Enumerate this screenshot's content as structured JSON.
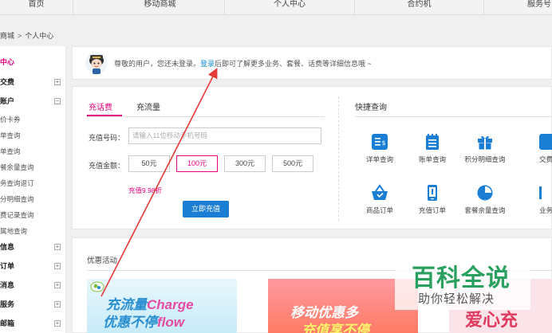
{
  "topnav": [
    "首页",
    "移动商城",
    "个人中心",
    "合约机",
    "服务号"
  ],
  "breadcrumb": [
    "商城",
    "个人中心"
  ],
  "sidebar": {
    "items": [
      {
        "label": "中心",
        "type": "active"
      },
      {
        "label": "交费",
        "type": "head",
        "toggle": "⊞"
      },
      {
        "label": "账户",
        "type": "head",
        "toggle": "⊟"
      },
      {
        "label": "价卡券",
        "type": "sub"
      },
      {
        "label": "单查询",
        "type": "sub"
      },
      {
        "label": "单查询",
        "type": "sub"
      },
      {
        "label": "餐余量查询",
        "type": "sub"
      },
      {
        "label": "务查询退订",
        "type": "sub"
      },
      {
        "label": "分明细查询",
        "type": "sub"
      },
      {
        "label": "费记录查询",
        "type": "sub"
      },
      {
        "label": "属地查询",
        "type": "sub"
      },
      {
        "label": "信息",
        "type": "head",
        "toggle": "⊞"
      },
      {
        "label": "订单",
        "type": "head",
        "toggle": "⊞"
      },
      {
        "label": "消息",
        "type": "head",
        "toggle": "⊞"
      },
      {
        "label": "服务",
        "type": "head",
        "toggle": "⊞"
      },
      {
        "label": "邮箱",
        "type": "head",
        "toggle": "⊞"
      }
    ]
  },
  "welcome": {
    "prefix": "尊敬的用户，您还未登录。",
    "login_link": "登录",
    "suffix": "后即可了解更多业务、套餐、话费等详细信息哦 ~"
  },
  "recharge": {
    "tabs": [
      "充话费",
      "充流量"
    ],
    "phone_label": "充值号码：",
    "phone_placeholder": "请输入11位移动手机号码",
    "amount_label": "充值金额：",
    "amounts": [
      "50元",
      "100元",
      "300元",
      "500元"
    ],
    "selected_amount": "100元",
    "discount": "充值9.98折",
    "submit_label": "立即充值"
  },
  "quick": {
    "title": "快捷查询",
    "items": [
      {
        "label": "详单查询",
        "icon": "bill-detail-icon"
      },
      {
        "label": "账单查询",
        "icon": "bill-icon"
      },
      {
        "label": "积分明细查询",
        "icon": "gift-icon"
      },
      {
        "label": "交费",
        "icon": "pay-icon"
      },
      {
        "label": "商品订单",
        "icon": "basket-icon"
      },
      {
        "label": "充值订单",
        "icon": "recharge-order-icon"
      },
      {
        "label": "套餐余量查询",
        "icon": "pie-icon"
      },
      {
        "label": "业务",
        "icon": "service-icon"
      }
    ]
  },
  "promo": {
    "title": "优惠活动",
    "banner1": {
      "line1_cn": "充流量",
      "line1_en": "Charge",
      "line2_cn": "优惠不停",
      "line2_en": "flow"
    },
    "banner2": {
      "line1": "移动优惠多",
      "line2": "充值享不停"
    },
    "banner3": {
      "text": "爱心充"
    }
  },
  "watermark": {
    "big": "百科全说",
    "small": "助你轻松解决"
  },
  "colors": {
    "accent": "#e4007f",
    "button": "#1a7fd4",
    "link": "#1a8bd8",
    "arrow": "#e53935",
    "icon": "#1a7fd4"
  }
}
